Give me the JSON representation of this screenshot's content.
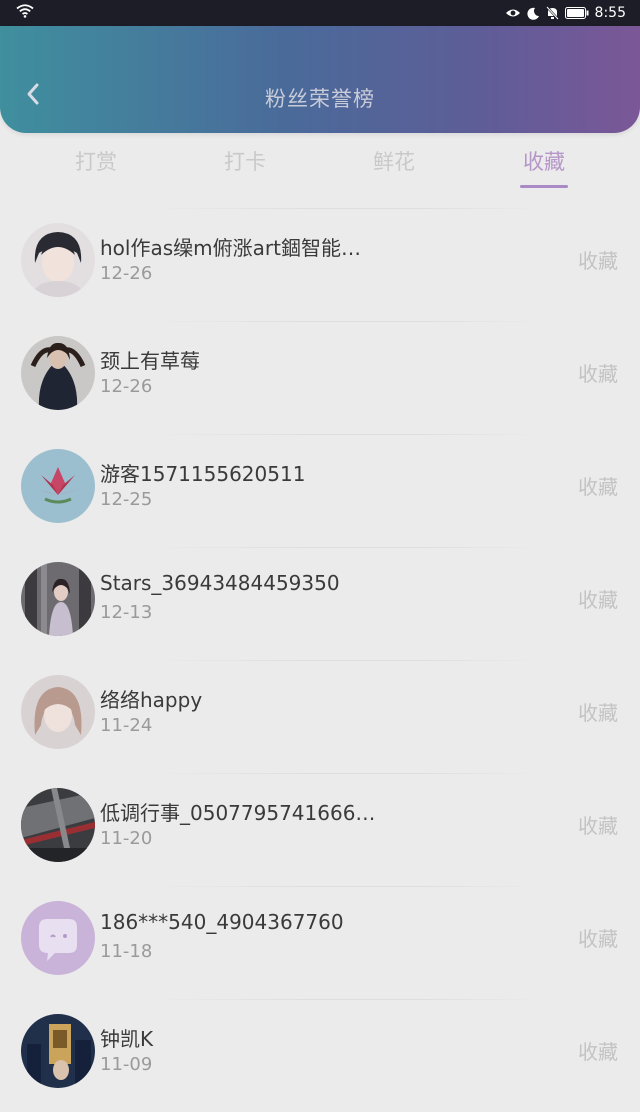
{
  "status_bar": {
    "time": "8:55",
    "icons": [
      "wifi-icon",
      "eye-icon",
      "moon-icon",
      "bell-off-icon",
      "battery-icon"
    ]
  },
  "header": {
    "title": "粉丝荣誉榜",
    "back_icon": "chevron-left-icon"
  },
  "tabs": [
    {
      "label": "打赏",
      "active": false
    },
    {
      "label": "打卡",
      "active": false
    },
    {
      "label": "鲜花",
      "active": false
    },
    {
      "label": "收藏",
      "active": true
    }
  ],
  "colors": {
    "accent": "#a98ac6",
    "header_start": "#3f8f9e",
    "header_end": "#7b5797",
    "background": "#ebebeb"
  },
  "fans": [
    {
      "name": "hol作as缲m俯涨art錮智能…",
      "date": "12-26",
      "action": "收藏"
    },
    {
      "name": "颈上有草莓",
      "date": "12-26",
      "action": "收藏"
    },
    {
      "name": "游客1571155620511",
      "date": "12-25",
      "action": "收藏"
    },
    {
      "name": "Stars_36943484459350",
      "date": "12-13",
      "action": "收藏"
    },
    {
      "name": "络络happy",
      "date": "11-24",
      "action": "收藏"
    },
    {
      "name": "低调行事_0507795741666…",
      "date": "11-20",
      "action": "收藏"
    },
    {
      "name": "186***540_4904367760",
      "date": "11-18",
      "action": "收藏"
    },
    {
      "name": "钟凯K",
      "date": "11-09",
      "action": "收藏"
    }
  ]
}
